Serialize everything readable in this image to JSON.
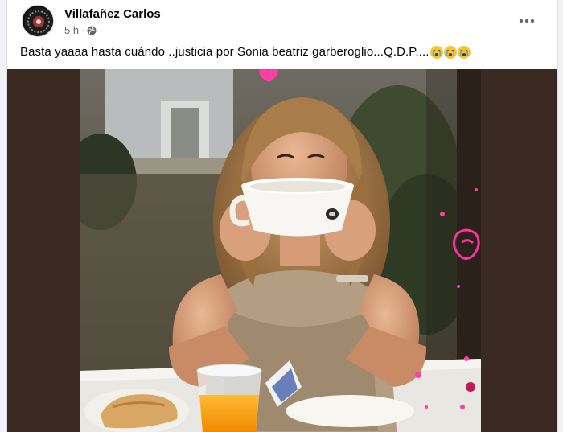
{
  "post": {
    "author": "Villafañez Carlos",
    "time": "5 h",
    "separator": "·",
    "visibility_icon": "globe-icon",
    "more_icon": "more-dots-icon",
    "text": "Basta yaaaa hasta cuándo ..justicia por Sonia beatriz garberoglio...Q.D.P....",
    "emojis": [
      "crying-face-icon",
      "crying-face-icon",
      "crying-face-icon"
    ]
  },
  "colors": {
    "author_text": "#050505",
    "meta_text": "#65676b",
    "frame_bg": "#3a2a22",
    "emoji_yellow": "#f7c531"
  }
}
